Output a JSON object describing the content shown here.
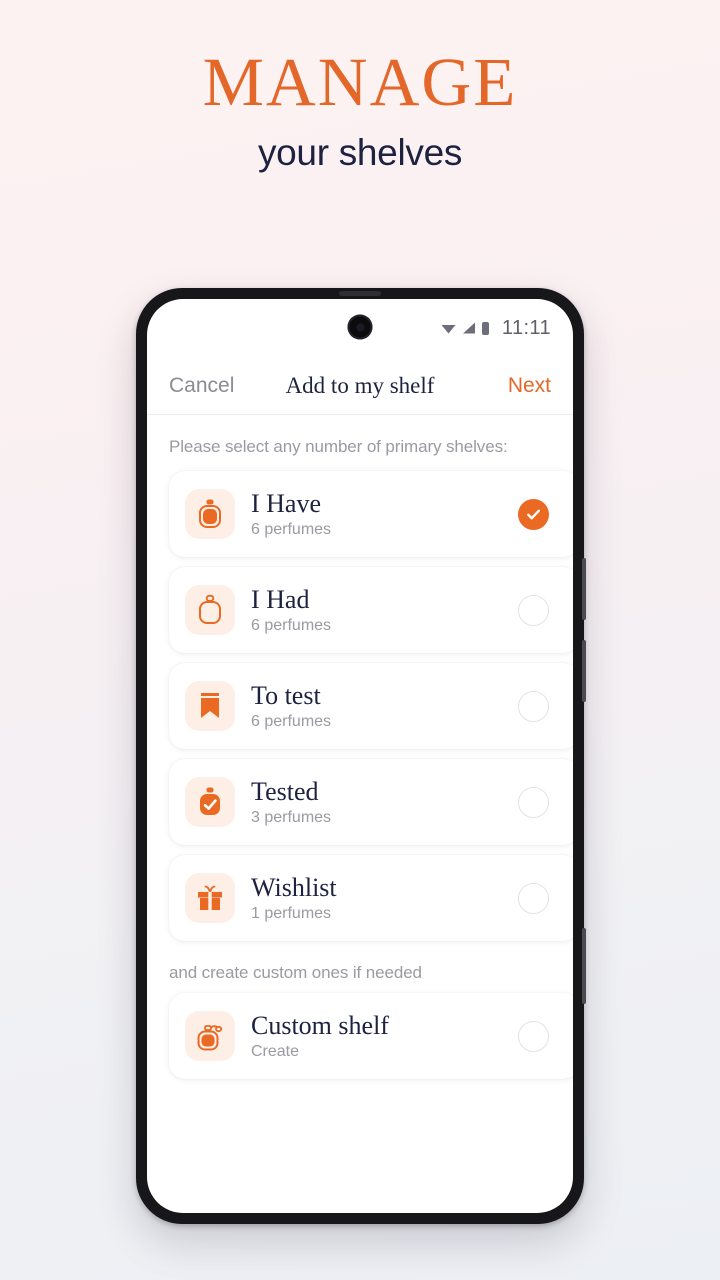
{
  "promo": {
    "headline": "MANAGE",
    "subheadline": "your shelves",
    "accent_color": "#e4672a",
    "text_color": "#1d2240"
  },
  "status_bar": {
    "time": "11:11",
    "icons": [
      "wifi-icon",
      "signal-icon",
      "battery-icon"
    ]
  },
  "navbar": {
    "cancel_label": "Cancel",
    "title": "Add to my shelf",
    "next_label": "Next"
  },
  "screen": {
    "primary_label": "Please select any number of primary shelves:",
    "custom_label": "and create custom ones if needed",
    "primary_shelves": [
      {
        "title": "I Have",
        "subtitle": "6 perfumes",
        "icon": "perfume-bottle-filled-icon",
        "selected": true
      },
      {
        "title": "I Had",
        "subtitle": "6 perfumes",
        "icon": "perfume-bottle-outline-icon",
        "selected": false
      },
      {
        "title": "To test",
        "subtitle": "6 perfumes",
        "icon": "bookmark-icon",
        "selected": false
      },
      {
        "title": "Tested",
        "subtitle": "3 perfumes",
        "icon": "perfume-bottle-check-icon",
        "selected": false
      },
      {
        "title": "Wishlist",
        "subtitle": "1 perfumes",
        "icon": "gift-icon",
        "selected": false
      }
    ],
    "custom_shelves": [
      {
        "title": "Custom shelf",
        "subtitle": "Create",
        "icon": "atomizer-bottle-icon",
        "selected": false
      }
    ]
  }
}
